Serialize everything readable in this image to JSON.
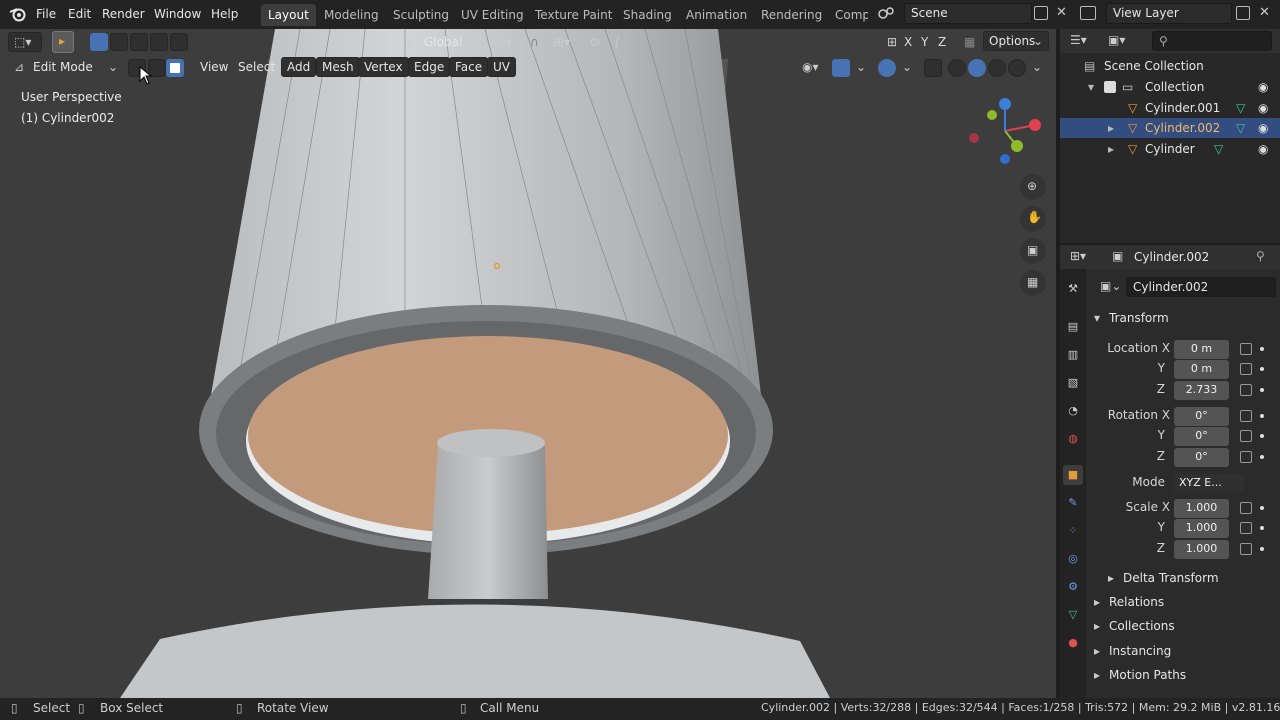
{
  "topbar": {
    "menus": [
      "File",
      "Edit",
      "Render",
      "Window",
      "Help"
    ],
    "workspaces": [
      "Layout",
      "Modeling",
      "Sculpting",
      "UV Editing",
      "Texture Paint",
      "Shading",
      "Animation",
      "Rendering",
      "Comp"
    ],
    "scene": "Scene",
    "view_layer": "View Layer"
  },
  "viewport_header": {
    "orientation": "Global",
    "axes": [
      "X",
      "Y",
      "Z"
    ],
    "options": "Options",
    "mode": "Edit Mode",
    "menus": [
      "View",
      "Select",
      "Add",
      "Mesh",
      "Vertex",
      "Edge",
      "Face",
      "UV"
    ]
  },
  "viewport": {
    "perspective": "User Perspective",
    "object": "(1) Cylinder002",
    "face_color": "#c49a7d"
  },
  "outliner": {
    "root": "Scene Collection",
    "collection": "Collection",
    "items": [
      {
        "label": "Cylinder.001",
        "selected": false
      },
      {
        "label": "Cylinder.002",
        "selected": true
      },
      {
        "label": "Cylinder",
        "selected": false
      }
    ]
  },
  "properties": {
    "header_object": "Cylinder.002",
    "object_name": "Cylinder.002",
    "section": "Transform",
    "location": {
      "label": "Location X",
      "x": "0 m",
      "y": "0 m",
      "z": "2.733"
    },
    "rotation": {
      "label": "Rotation X",
      "x": "0°",
      "y": "0°",
      "z": "0°"
    },
    "mode": {
      "label": "Mode",
      "value": "XYZ E..."
    },
    "scale": {
      "label": "Scale X",
      "x": "1.000",
      "y": "1.000",
      "z": "1.000"
    },
    "axis_y": "Y",
    "axis_z": "Z",
    "delta": "Delta Transform",
    "sections": [
      "Relations",
      "Collections",
      "Instancing",
      "Motion Paths"
    ]
  },
  "statusbar": {
    "select": "Select",
    "box_select": "Box Select",
    "rotate": "Rotate View",
    "call_menu": "Call Menu",
    "stats": "Cylinder.002 | Verts:32/288 | Edges:32/544 | Faces:1/258 | Tris:572 | Mem: 29.2 MiB | v2.81.16"
  }
}
